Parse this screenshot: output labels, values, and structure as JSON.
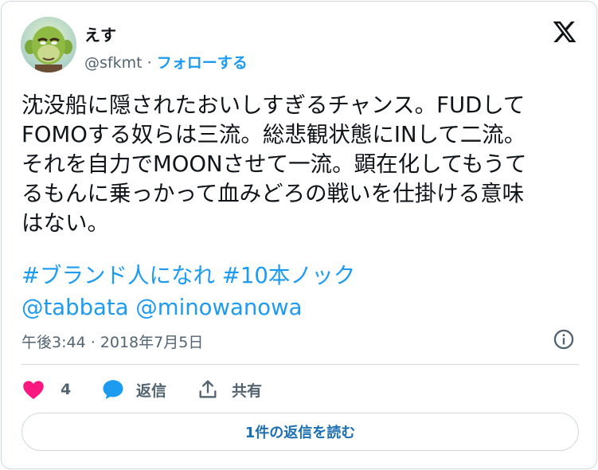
{
  "author": {
    "name": "えす",
    "handle": "@sfkmt",
    "separator": "·",
    "follow_label": "フォローする"
  },
  "tweet": {
    "text": "沈没船に隠されたおいしすぎるチャンス。FUDして\nFOMOする奴らは三流。総悲観状態にINして二流。\nそれを自力でMOONさせて一流。顕在化してもうて\nるもんに乗っかって血みどろの戦いを仕掛ける意味\nはない。",
    "hashtags": [
      "#ブランド人になれ",
      "#10本ノック"
    ],
    "mentions": [
      "@tabbata",
      "@minowanowa"
    ],
    "timestamp": "午後3:44 · 2018年7月5日"
  },
  "actions": {
    "like_count": "4",
    "reply_label": "返信",
    "share_label": "共有"
  },
  "read_replies_label": "1件の返信を読む",
  "icons": {
    "platform_logo": "x-logo-icon",
    "info": "info-icon",
    "like": "heart-icon",
    "reply": "chat-bubble-icon",
    "share": "share-upload-icon"
  },
  "colors": {
    "accent": "#1d9bf0",
    "like": "#f91880",
    "muted": "#536471",
    "border": "#cfd9de"
  }
}
